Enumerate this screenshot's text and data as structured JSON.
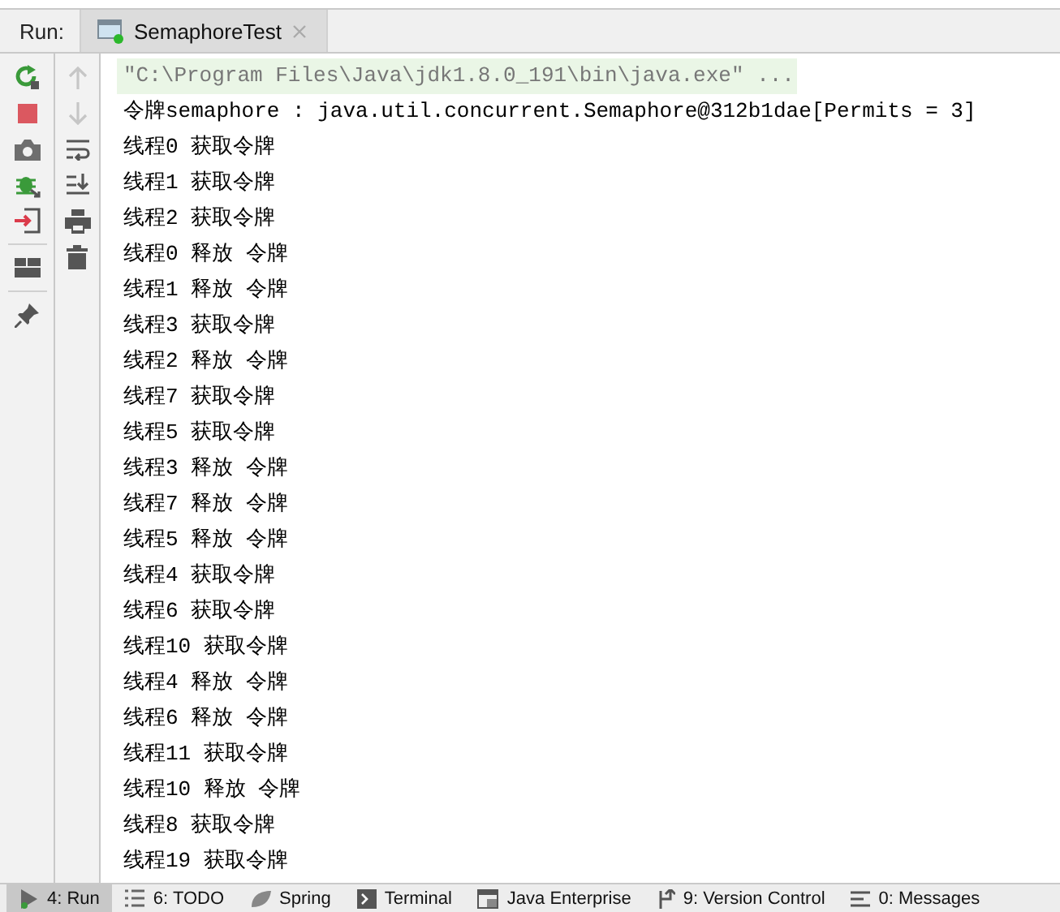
{
  "run_panel": {
    "label": "Run:",
    "tabs": [
      {
        "label": "SemaphoreTest",
        "selected": true
      }
    ]
  },
  "left_toolbar": [
    {
      "kind": "rerun",
      "disabled": false
    },
    {
      "kind": "stop",
      "disabled": false
    },
    {
      "kind": "camera",
      "disabled": false
    },
    {
      "kind": "bug",
      "disabled": false
    },
    {
      "kind": "exit",
      "disabled": false
    },
    {
      "kind": "sep"
    },
    {
      "kind": "layout",
      "disabled": false
    },
    {
      "kind": "sep"
    },
    {
      "kind": "pin",
      "disabled": false
    }
  ],
  "right_toolbar": [
    {
      "kind": "up",
      "disabled": true
    },
    {
      "kind": "down",
      "disabled": true
    },
    {
      "kind": "wrap",
      "disabled": false
    },
    {
      "kind": "scroll",
      "disabled": false
    },
    {
      "kind": "print",
      "disabled": false
    },
    {
      "kind": "trash",
      "disabled": false
    }
  ],
  "console_lines": [
    {
      "kind": "command",
      "text": "\"C:\\Program Files\\Java\\jdk1.8.0_191\\bin\\java.exe\" ..."
    },
    {
      "kind": "output",
      "text": "令牌semaphore : java.util.concurrent.Semaphore@312b1dae[Permits = 3]"
    },
    {
      "kind": "output",
      "text": "线程0 获取令牌"
    },
    {
      "kind": "output",
      "text": "线程1 获取令牌"
    },
    {
      "kind": "output",
      "text": "线程2 获取令牌"
    },
    {
      "kind": "output",
      "text": "线程0 释放 令牌"
    },
    {
      "kind": "output",
      "text": "线程1 释放 令牌"
    },
    {
      "kind": "output",
      "text": "线程3 获取令牌"
    },
    {
      "kind": "output",
      "text": "线程2 释放 令牌"
    },
    {
      "kind": "output",
      "text": "线程7 获取令牌"
    },
    {
      "kind": "output",
      "text": "线程5 获取令牌"
    },
    {
      "kind": "output",
      "text": "线程3 释放 令牌"
    },
    {
      "kind": "output",
      "text": "线程7 释放 令牌"
    },
    {
      "kind": "output",
      "text": "线程5 释放 令牌"
    },
    {
      "kind": "output",
      "text": "线程4 获取令牌"
    },
    {
      "kind": "output",
      "text": "线程6 获取令牌"
    },
    {
      "kind": "output",
      "text": "线程10 获取令牌"
    },
    {
      "kind": "output",
      "text": "线程4 释放 令牌"
    },
    {
      "kind": "output",
      "text": "线程6 释放 令牌"
    },
    {
      "kind": "output",
      "text": "线程11 获取令牌"
    },
    {
      "kind": "output",
      "text": "线程10 释放 令牌"
    },
    {
      "kind": "output",
      "text": "线程8 获取令牌"
    },
    {
      "kind": "output",
      "text": "线程19 获取令牌"
    }
  ],
  "tool_windows": [
    {
      "kind": "run",
      "label": "4: Run",
      "selected": true
    },
    {
      "kind": "todo",
      "label": "6: TODO",
      "selected": false
    },
    {
      "kind": "spring",
      "label": "Spring",
      "selected": false
    },
    {
      "kind": "terminal",
      "label": "Terminal",
      "selected": false
    },
    {
      "kind": "enterprise",
      "label": "Java Enterprise",
      "selected": false
    },
    {
      "kind": "vcs",
      "label": "9: Version Control",
      "selected": false
    },
    {
      "kind": "messages",
      "label": "0: Messages",
      "selected": false
    }
  ]
}
